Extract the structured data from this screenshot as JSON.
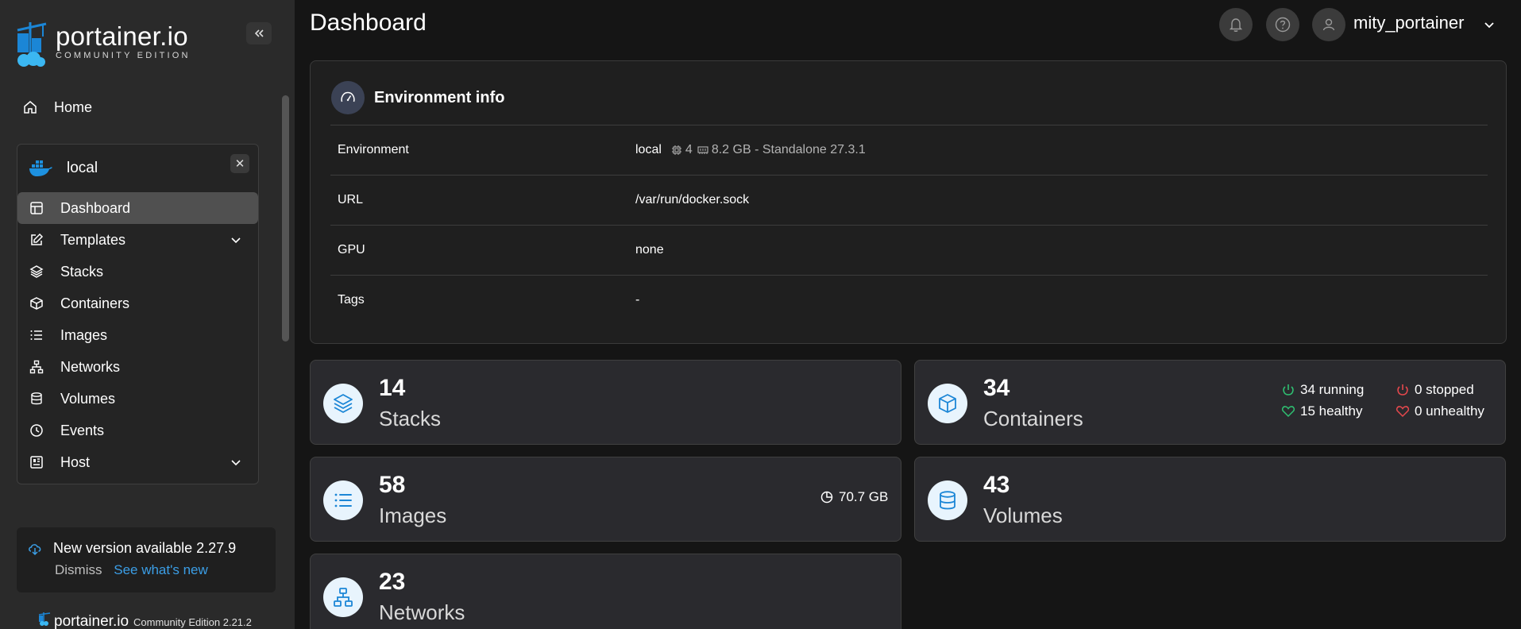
{
  "sidebar": {
    "logo_name": "portainer.io",
    "logo_edition": "COMMUNITY EDITION",
    "home_label": "Home",
    "environment": {
      "name": "local",
      "items": [
        {
          "label": "Dashboard",
          "icon": "dashboard-icon",
          "active": true
        },
        {
          "label": "Templates",
          "icon": "edit-icon",
          "expandable": true
        },
        {
          "label": "Stacks",
          "icon": "layers-icon"
        },
        {
          "label": "Containers",
          "icon": "box-icon"
        },
        {
          "label": "Images",
          "icon": "list-icon"
        },
        {
          "label": "Networks",
          "icon": "network-icon"
        },
        {
          "label": "Volumes",
          "icon": "database-icon"
        },
        {
          "label": "Events",
          "icon": "clock-icon"
        },
        {
          "label": "Host",
          "icon": "host-icon",
          "expandable": true
        }
      ]
    },
    "update": {
      "title": "New version available 2.27.9",
      "dismiss": "Dismiss",
      "see_new": "See what's new"
    },
    "footer": {
      "name": "portainer.io",
      "edition": "Community Edition 2.21.2"
    }
  },
  "header": {
    "title": "Dashboard",
    "username": "mity_portainer"
  },
  "env_info": {
    "title": "Environment info",
    "rows": {
      "environment": {
        "label": "Environment",
        "name": "local",
        "cpu": "4",
        "memory": "8.2 GB - Standalone 27.3.1"
      },
      "url": {
        "label": "URL",
        "value": "/var/run/docker.sock"
      },
      "gpu": {
        "label": "GPU",
        "value": "none"
      },
      "tags": {
        "label": "Tags",
        "value": "-"
      }
    }
  },
  "stats": {
    "stacks": {
      "count": "14",
      "label": "Stacks"
    },
    "containers": {
      "count": "34",
      "label": "Containers",
      "running": "34 running",
      "stopped": "0 stopped",
      "healthy": "15 healthy",
      "unhealthy": "0 unhealthy"
    },
    "images": {
      "count": "58",
      "label": "Images",
      "size": "70.7 GB"
    },
    "volumes": {
      "count": "43",
      "label": "Volumes"
    },
    "networks": {
      "count": "23",
      "label": "Networks"
    }
  },
  "colors": {
    "accent": "#3b9ee6",
    "icon_blue": "#1b86d6",
    "running_green": "#2fbf71",
    "stopped_red": "#e5484d"
  }
}
